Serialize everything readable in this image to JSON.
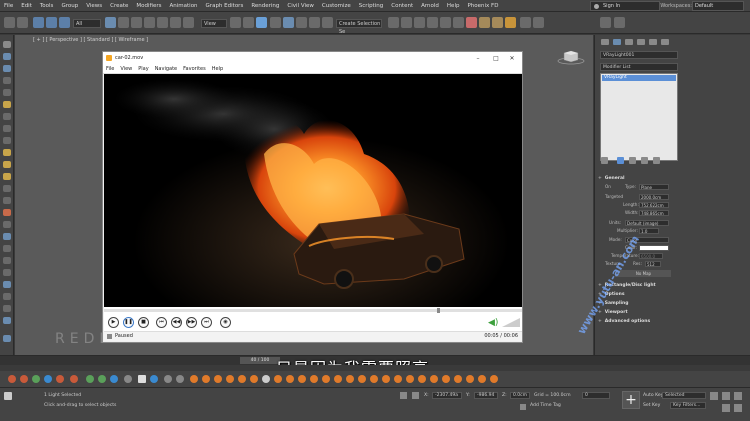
{
  "menubar": {
    "items": [
      "File",
      "Edit",
      "Tools",
      "Group",
      "Views",
      "Create",
      "Modifiers",
      "Animation",
      "Graph Editors",
      "Rendering",
      "Civil View",
      "Customize",
      "Scripting",
      "Content",
      "Arnold",
      "Help",
      "Phoenix FD"
    ],
    "sign_in": "Sign In",
    "workspaces_label": "Workspaces:",
    "workspace_value": "Default"
  },
  "toolbar": {
    "filter_value": "All",
    "view_value": "View",
    "selection_set": "Create Selection Se"
  },
  "viewport": {
    "label": "[ + ] [ Perspective ] [ Standard ] [ Wireframe ]",
    "watermark": "REDEFINEFX.COM"
  },
  "player": {
    "title": "car-02.mov",
    "menu": [
      "File",
      "View",
      "Play",
      "Navigate",
      "Favorites",
      "Help"
    ],
    "status": "Paused",
    "time": "00:05 / 00:06"
  },
  "command_panel": {
    "object_name": "VRayLight001",
    "modifier_list": "Modifier List",
    "stack_item": "VRayLight",
    "rollouts": {
      "general": "General",
      "rectangle": "Rectangle/Disc light",
      "options": "Options",
      "sampling": "Sampling",
      "viewport": "Viewport",
      "advanced": "Advanced options"
    },
    "params": {
      "on": "On",
      "type_label": "Type:",
      "type_value": "Plane",
      "targeted": "Targeted",
      "targeted_value": "2000.0cm",
      "length_label": "Length:",
      "length_value": "752.622cm",
      "width_label": "Width:",
      "width_value": "748.865cm",
      "units_label": "Units:",
      "units_value": "Default (image)",
      "multiplier_label": "Multiplier:",
      "multiplier_value": "1.0",
      "mode_label": "Mode:",
      "mode_value": "Color",
      "color_label": "Color:",
      "temperature_label": "Temperature:",
      "temperature_value": "6500.0",
      "texture_label": "Texture",
      "res_label": "Res:",
      "res_value": "512",
      "no_map": "No Map"
    }
  },
  "timeline": {
    "frame": "40 / 100",
    "subtitle": "只是因为我需要照亮"
  },
  "vertical_watermark": "www.yutu-an.com",
  "statusbar": {
    "selection": "1 Light Selected",
    "prompt": "Click and-drag to select objects",
    "x_label": "X:",
    "x_value": "-2307.49a",
    "y_label": "Y:",
    "y_value": "-986.94",
    "z_label": "Z:",
    "z_value": "0.0cm",
    "grid": "Grid = 100.0cm",
    "add_time_tag": "Add Time Tag",
    "auto_key": "Auto Key",
    "set_key": "Set Key",
    "selected": "Selected",
    "key_filters": "Key Filters...",
    "frame_value": "0"
  }
}
